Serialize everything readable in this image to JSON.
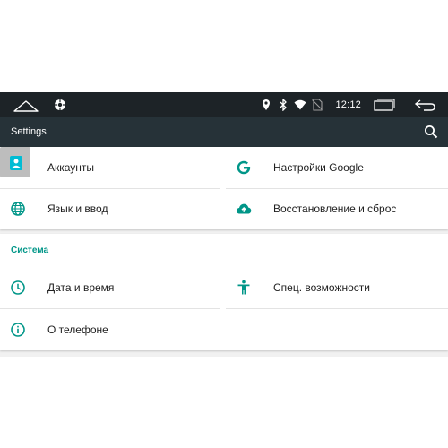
{
  "status_bar": {
    "time": "12:12",
    "icons": [
      "home-outline-icon",
      "settings-app-icon",
      "location-icon",
      "bluetooth-icon",
      "wifi-icon",
      "no-sim-icon",
      "recents-icon",
      "back-icon"
    ]
  },
  "app_bar": {
    "title": "Settings",
    "search_icon": "search-icon"
  },
  "personal": {
    "items": [
      {
        "label": "Аккаунты",
        "icon": "account-icon"
      },
      {
        "label": "Настройки Google",
        "icon": "google-icon"
      },
      {
        "label": "Язык и ввод",
        "icon": "globe-icon"
      },
      {
        "label": "Восстановление и сброс",
        "icon": "cloud-upload-icon"
      }
    ]
  },
  "system": {
    "title": "Система",
    "items": [
      {
        "label": "Дата и время",
        "icon": "clock-icon"
      },
      {
        "label": "Спец. возможности",
        "icon": "accessibility-icon"
      },
      {
        "label": "О телефоне",
        "icon": "info-icon"
      }
    ]
  },
  "colors": {
    "accent": "#009688",
    "status_bar": "#1d2327",
    "app_bar": "#263238"
  }
}
